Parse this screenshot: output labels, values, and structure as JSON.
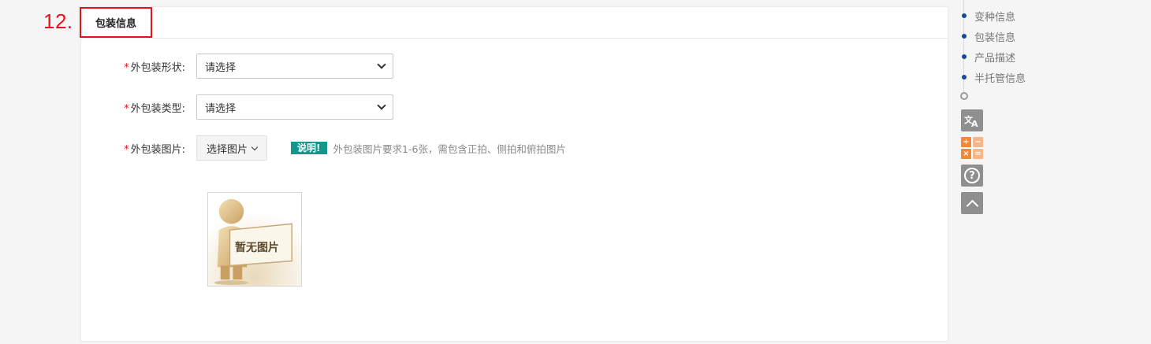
{
  "step_number": "12.",
  "section": {
    "title": "包装信息",
    "fields": [
      {
        "required_mark": "*",
        "label": "外包装形状:",
        "value": "请选择"
      },
      {
        "required_mark": "*",
        "label": "外包装类型:",
        "value": "请选择"
      }
    ],
    "image_field": {
      "required_mark": "*",
      "label": "外包装图片:",
      "button_label": "选择图片",
      "note_badge": "说明!",
      "note_text": "外包装图片要求1-6张，需包含正拍、侧拍和俯拍图片",
      "placeholder_text": "暂无图片"
    }
  },
  "nav": {
    "items": [
      {
        "label": "变种信息"
      },
      {
        "label": "包装信息"
      },
      {
        "label": "产品描述"
      },
      {
        "label": "半托管信息"
      }
    ],
    "tools": [
      "translate-icon",
      "calculator-icon",
      "help-icon",
      "back-to-top-icon"
    ]
  },
  "colors": {
    "accent_red": "#e3131b",
    "nav_dot": "#164b93",
    "note_badge": "#14968d",
    "tool_grey": "#8f8f8f",
    "calc_orange": "#f2883a"
  }
}
